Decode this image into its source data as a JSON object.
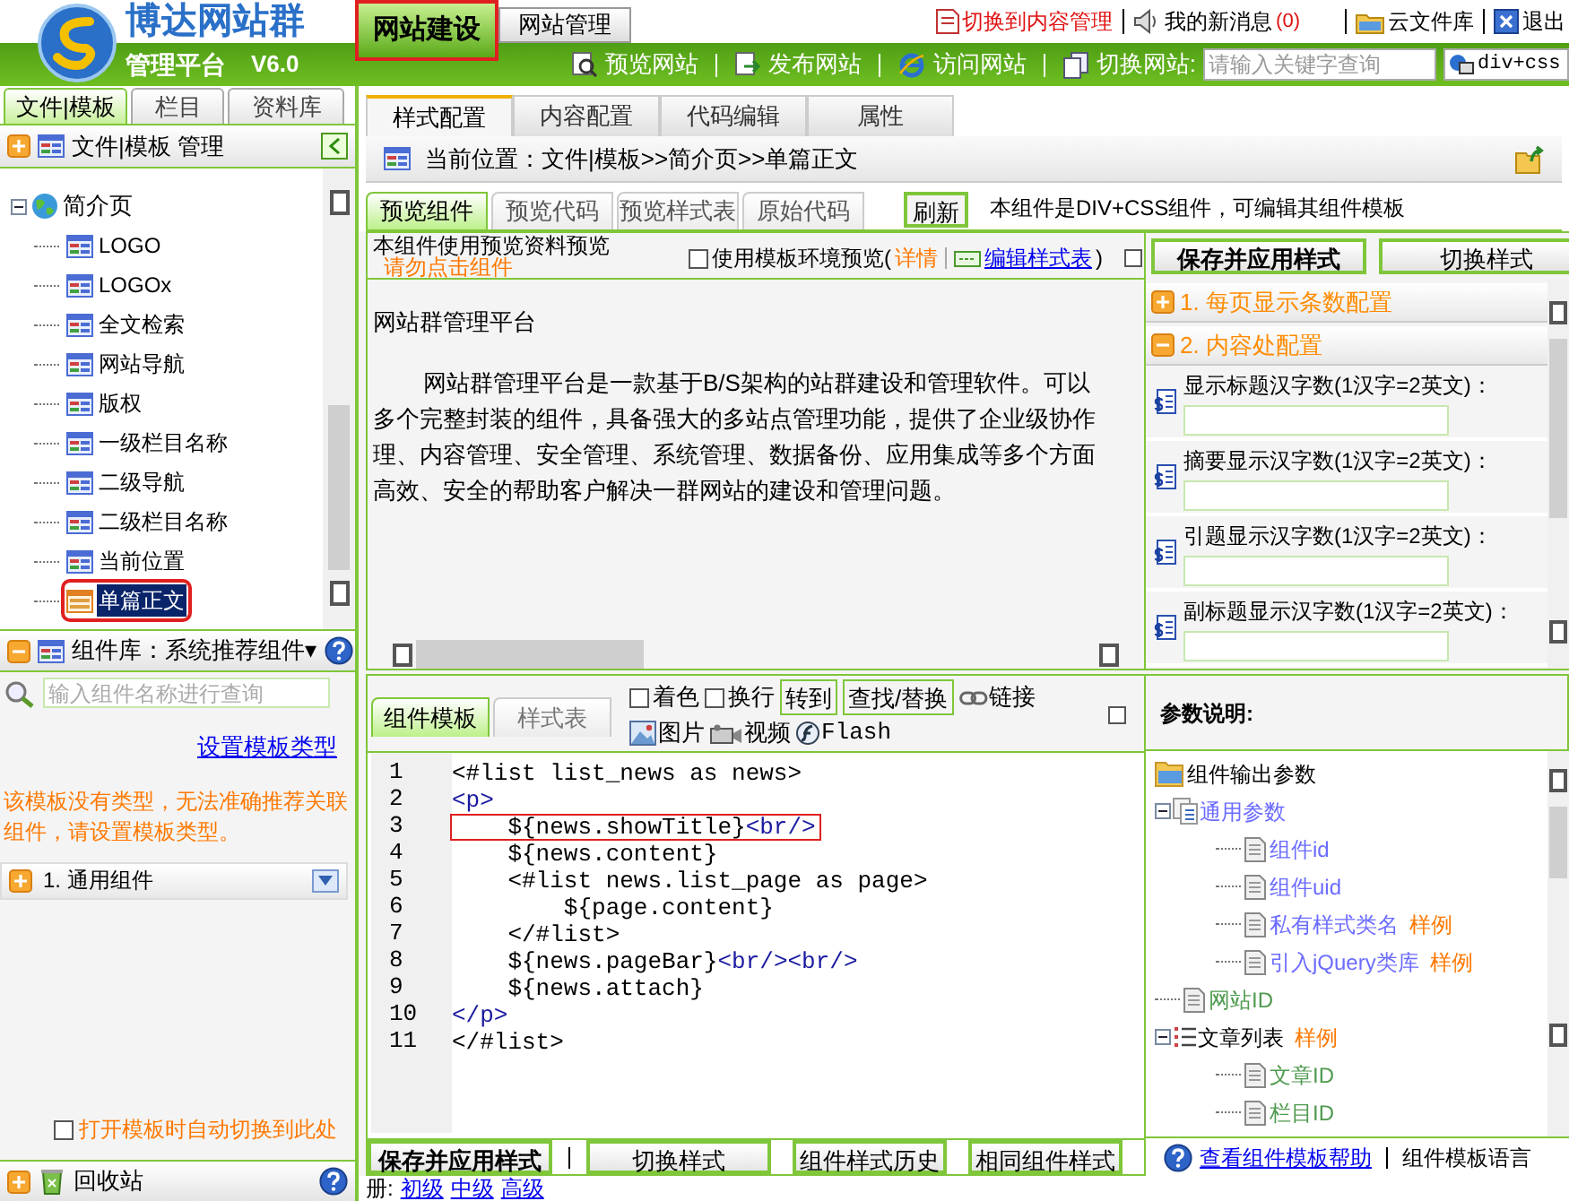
{
  "header": {
    "logo_title": "博达网站群",
    "logo_subtitle": "管理平台",
    "version": "V6.0",
    "main_tabs": [
      {
        "label": "网站建设",
        "selected": true,
        "highlighted": true
      },
      {
        "label": "网站管理",
        "selected": false,
        "highlighted": false
      }
    ],
    "top_links": [
      {
        "label": "切换到内容管理",
        "kind": "switch"
      },
      {
        "label": "我的新消息",
        "kind": "messages",
        "count": "(0)"
      },
      {
        "label": "云文件库",
        "kind": "cloud"
      },
      {
        "label": "退出",
        "kind": "exit"
      }
    ],
    "actions": [
      {
        "label": "预览网站",
        "kind": "preview"
      },
      {
        "label": "发布网站",
        "kind": "publish"
      },
      {
        "label": "访问网站",
        "kind": "visit"
      },
      {
        "label": "切换网站:",
        "kind": "switch"
      }
    ],
    "search": {
      "placeholder": "请输入关键字查询"
    },
    "site_select": "div+css"
  },
  "sidebar": {
    "tabs": [
      {
        "label": "文件|模板",
        "selected": true
      },
      {
        "label": "栏目",
        "selected": false
      },
      {
        "label": "资料库",
        "selected": false
      }
    ],
    "panel_title": "文件|模板 管理",
    "tree": [
      {
        "label": "简介页",
        "expanded": true,
        "children": [
          {
            "label": "LOGO",
            "selected": false,
            "highlighted": false
          },
          {
            "label": "LOGOx",
            "selected": false,
            "highlighted": false
          },
          {
            "label": "全文检索",
            "selected": false,
            "highlighted": false
          },
          {
            "label": "网站导航",
            "selected": false,
            "highlighted": false
          },
          {
            "label": "版权",
            "selected": false,
            "highlighted": false
          },
          {
            "label": "一级栏目名称",
            "selected": false,
            "highlighted": false
          },
          {
            "label": "二级导航",
            "selected": false,
            "highlighted": false
          },
          {
            "label": "二级栏目名称",
            "selected": false,
            "highlighted": false
          },
          {
            "label": "当前位置",
            "selected": false,
            "highlighted": false
          },
          {
            "label": "单篇正文",
            "selected": true,
            "highlighted": true
          }
        ]
      }
    ],
    "library": {
      "title": "组件库：系统推荐组件▾",
      "search": {
        "placeholder": "输入组件名称进行查询"
      },
      "set_type_link": "设置模板类型",
      "warning": "该模板没有类型，无法准确推荐关联组件，请设置模板类型。",
      "groups": [
        {
          "label": "1.  通用组件",
          "expanded": false
        }
      ],
      "auto_switch": {
        "label": "打开模板时自动切换到此处",
        "checked": false
      }
    },
    "recycle_bin": "回收站"
  },
  "main": {
    "tabs": [
      {
        "label": "样式配置",
        "selected": true
      },
      {
        "label": "内容配置",
        "selected": false
      },
      {
        "label": "代码编辑",
        "selected": false
      },
      {
        "label": "属性",
        "selected": false
      }
    ],
    "breadcrumb": "当前位置：文件|模板>>简介页>>单篇正文",
    "view_tabs": [
      {
        "label": "预览组件",
        "selected": true
      },
      {
        "label": "预览代码",
        "selected": false
      },
      {
        "label": "预览样式表",
        "selected": false
      },
      {
        "label": "原始代码",
        "selected": false
      }
    ],
    "refresh_button": "刷新",
    "component_note": "本组件是DIV+CSS组件，可编辑其组件模板",
    "preview": {
      "note": "本组件使用预览资料预览",
      "warning": "请勿点击组件",
      "env_preview": {
        "label": "使用模板环境预览(",
        "checked": false
      },
      "details_link": "详情",
      "edit_stylesheet_link": "编辑样式表",
      "close_paren": ")",
      "title": "网站群管理平台",
      "lines": [
        "网站群管理平台是一款基于B/S架构的站群建设和管理软件。可以",
        "多个完整封装的组件，具备强大的多站点管理功能，提供了企业级协作",
        "理、内容管理、安全管理、系统管理、数据备份、应用集成等多个方面",
        "高效、安全的帮助客户解决一群网站的建设和管理问题。"
      ]
    },
    "style_panel": {
      "buttons": [
        {
          "label": "保存并应用样式",
          "kind": "primary"
        },
        {
          "label": "切换样式",
          "kind": "normal"
        }
      ],
      "sections": [
        {
          "label": "1. 每页显示条数配置",
          "expanded": false
        },
        {
          "label": "2. 内容处配置",
          "expanded": true
        }
      ],
      "fields": [
        "显示标题汉字数(1汉字=2英文)：",
        "摘要显示汉字数(1汉字=2英文)：",
        "引题显示汉字数(1汉字=2英文)：",
        "副标题显示汉字数(1汉字=2英文)："
      ]
    },
    "editor": {
      "tabs": [
        {
          "label": "组件模板",
          "selected": true
        },
        {
          "label": "样式表",
          "selected": false
        }
      ],
      "toolbar": [
        {
          "label": "着色",
          "kind": "checkbox",
          "checked": false
        },
        {
          "label": "换行",
          "kind": "checkbox",
          "checked": false
        },
        {
          "label": "转到",
          "kind": "button"
        },
        {
          "label": "查找/替换",
          "kind": "button"
        },
        {
          "label": "链接",
          "kind": "link"
        },
        {
          "label": "图片",
          "kind": "image"
        },
        {
          "label": "视频",
          "kind": "video"
        },
        {
          "label": "Flash",
          "kind": "flash"
        }
      ],
      "lines": [
        {
          "num": "1",
          "highlighted": false,
          "parts": [
            {
              "text": "<#list list_news as news>",
              "kind": "plain"
            }
          ]
        },
        {
          "num": "2",
          "highlighted": false,
          "parts": [
            {
              "text": "<p>",
              "kind": "tag"
            }
          ]
        },
        {
          "num": "3",
          "highlighted": true,
          "parts": [
            {
              "text": "    ${news.showTitle}",
              "kind": "plain"
            },
            {
              "text": "<br/>",
              "kind": "tag"
            }
          ]
        },
        {
          "num": "4",
          "highlighted": false,
          "parts": [
            {
              "text": "    ${news.content}",
              "kind": "plain"
            }
          ]
        },
        {
          "num": "5",
          "highlighted": false,
          "parts": [
            {
              "text": "    <#list news.list_page as page>",
              "kind": "plain"
            }
          ]
        },
        {
          "num": "6",
          "highlighted": false,
          "parts": [
            {
              "text": "        ${page.content}",
              "kind": "plain"
            }
          ]
        },
        {
          "num": "7",
          "highlighted": false,
          "parts": [
            {
              "text": "    </#list>",
              "kind": "plain"
            }
          ]
        },
        {
          "num": "8",
          "highlighted": false,
          "parts": [
            {
              "text": "    ${news.pageBar}",
              "kind": "plain"
            },
            {
              "text": "<br/><br/>",
              "kind": "tag"
            }
          ]
        },
        {
          "num": "9",
          "highlighted": false,
          "parts": [
            {
              "text": "    ${news.attach}",
              "kind": "plain"
            }
          ]
        },
        {
          "num": "10",
          "highlighted": false,
          "parts": [
            {
              "text": "</p>",
              "kind": "tag"
            }
          ]
        },
        {
          "num": "11",
          "highlighted": false,
          "parts": [
            {
              "text": "</#list>",
              "kind": "plain"
            }
          ]
        }
      ],
      "bottom_buttons": [
        {
          "label": "保存并应用样式",
          "kind": "primary"
        },
        {
          "label": "切换样式",
          "kind": "normal"
        },
        {
          "label": "组件样式历史",
          "kind": "normal"
        },
        {
          "label": "相同组件样式",
          "kind": "normal"
        }
      ],
      "level_prefix": "册:",
      "level_links": [
        "初级",
        "中级",
        "高级"
      ]
    },
    "params": {
      "title": "参数说明:",
      "tree": [
        {
          "label": "组件输出参数",
          "kind": "root",
          "color": "#000000",
          "children": [
            {
              "label": "通用参数",
              "kind": "group",
              "color": "#6b6bff",
              "expanded": true,
              "children": [
                {
                  "label": "组件id",
                  "kind": "item",
                  "color": "#6b6bff"
                },
                {
                  "label": "组件uid",
                  "kind": "item",
                  "color": "#6b6bff"
                },
                {
                  "label": "私有样式类名",
                  "kind": "item",
                  "color": "#6b6bff",
                  "example": "样例"
                },
                {
                  "label": "引入jQuery类库",
                  "kind": "item",
                  "color": "#6b6bff",
                  "example": "样例"
                }
              ]
            },
            {
              "label": "网站ID",
              "kind": "item",
              "color": "#4f9a4f"
            },
            {
              "label": "文章列表",
              "kind": "list",
              "color": "#000000",
              "example": "样例",
              "expanded": true,
              "children": [
                {
                  "label": "文章ID",
                  "kind": "item",
                  "color": "#4f9a4f"
                },
                {
                  "label": "栏目ID",
                  "kind": "item",
                  "color": "#4f9a4f"
                }
              ]
            }
          ]
        }
      ],
      "help_link": "查看组件模板帮助",
      "language_manual": "组件模板语言"
    }
  }
}
